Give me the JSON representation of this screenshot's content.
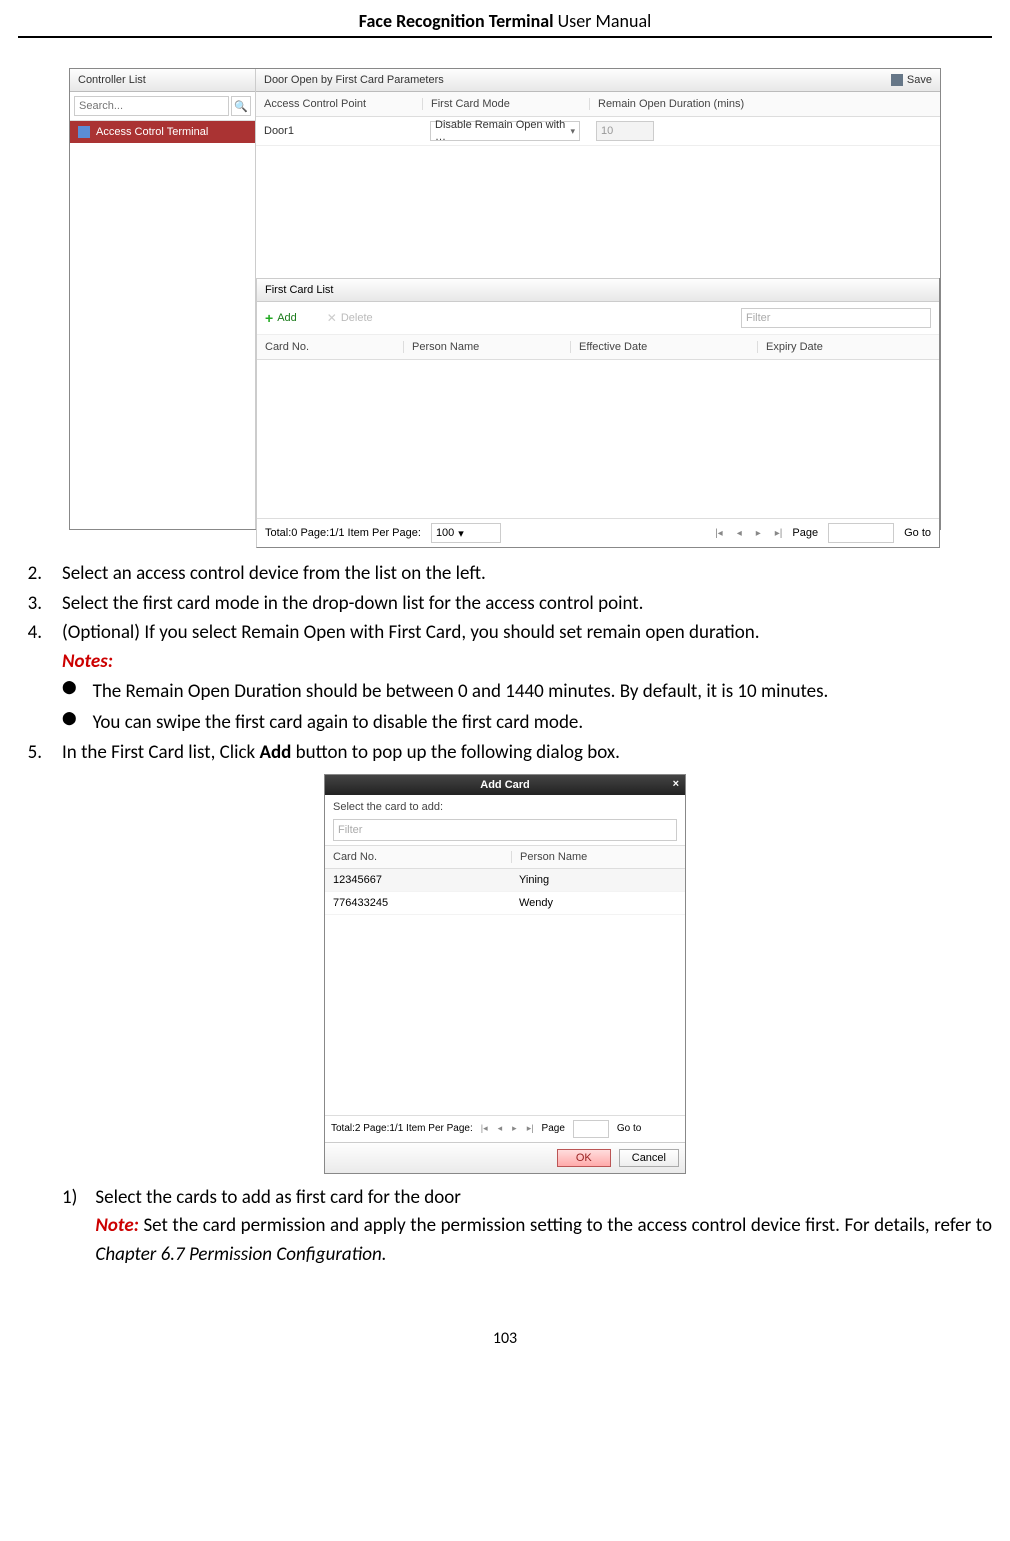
{
  "doc_header": {
    "bold": "Face Recognition Terminal",
    "rest": "  User Manual"
  },
  "page_number": "103",
  "ss1": {
    "controller_list_title": "Controller List",
    "search_placeholder": "Search...",
    "selected_device": "Access Cotrol Terminal",
    "right_title": "Door Open by First Card Parameters",
    "save_label": "Save",
    "cols": {
      "acp": "Access Control Point",
      "fcm": "First Card Mode",
      "rod": "Remain Open Duration (mins)"
    },
    "row": {
      "door": "Door1",
      "mode": "Disable Remain Open with …",
      "duration": "10"
    },
    "first_card_list_title": "First Card List",
    "add_label": "Add",
    "delete_label": "Delete",
    "filter_placeholder": "Filter",
    "list_cols": {
      "card_no": "Card No.",
      "person": "Person Name",
      "eff": "Effective Date",
      "exp": "Expiry Date"
    },
    "pagination": {
      "status": "Total:0   Page:1/1   Item Per Page:",
      "items": "100",
      "page_label": "Page",
      "goto_label": "Go to"
    }
  },
  "instr": {
    "l2": "Select an access control device from the list on the left.",
    "l3": "Select the first card mode in the drop-down list for the access control point.",
    "l4": "(Optional) If you select Remain Open with First Card, you should set remain open duration.",
    "notes_label": "Notes:",
    "b1": "The Remain Open Duration should be between 0 and 1440 minutes. By default, it is 10 minutes.",
    "b2": "You can swipe the first card again to disable the first card mode.",
    "l5_pre": "In the First Card list, Click ",
    "l5_bold": "Add",
    "l5_post": " button to pop up the following dialog box.",
    "s1": "Select the cards to add as first card for the door",
    "note_label": "Note:",
    "s1_note": " Set the card permission and apply the permission setting to the access control device first. For details, refer to ",
    "s1_ref": "Chapter 6.7 Permission Configuration."
  },
  "ss2": {
    "title": "Add Card",
    "prompt": "Select the card to add:",
    "filter_placeholder": "Filter",
    "cols": {
      "card_no": "Card No.",
      "person": "Person Name"
    },
    "rows": [
      {
        "card": "12345667",
        "person": "Yining"
      },
      {
        "card": "776433245",
        "person": "Wendy"
      }
    ],
    "pagination": {
      "status": "Total:2   Page:1/1   Item Per Page:",
      "page_label": "Page",
      "goto_label": "Go to"
    },
    "ok": "OK",
    "cancel": "Cancel"
  }
}
